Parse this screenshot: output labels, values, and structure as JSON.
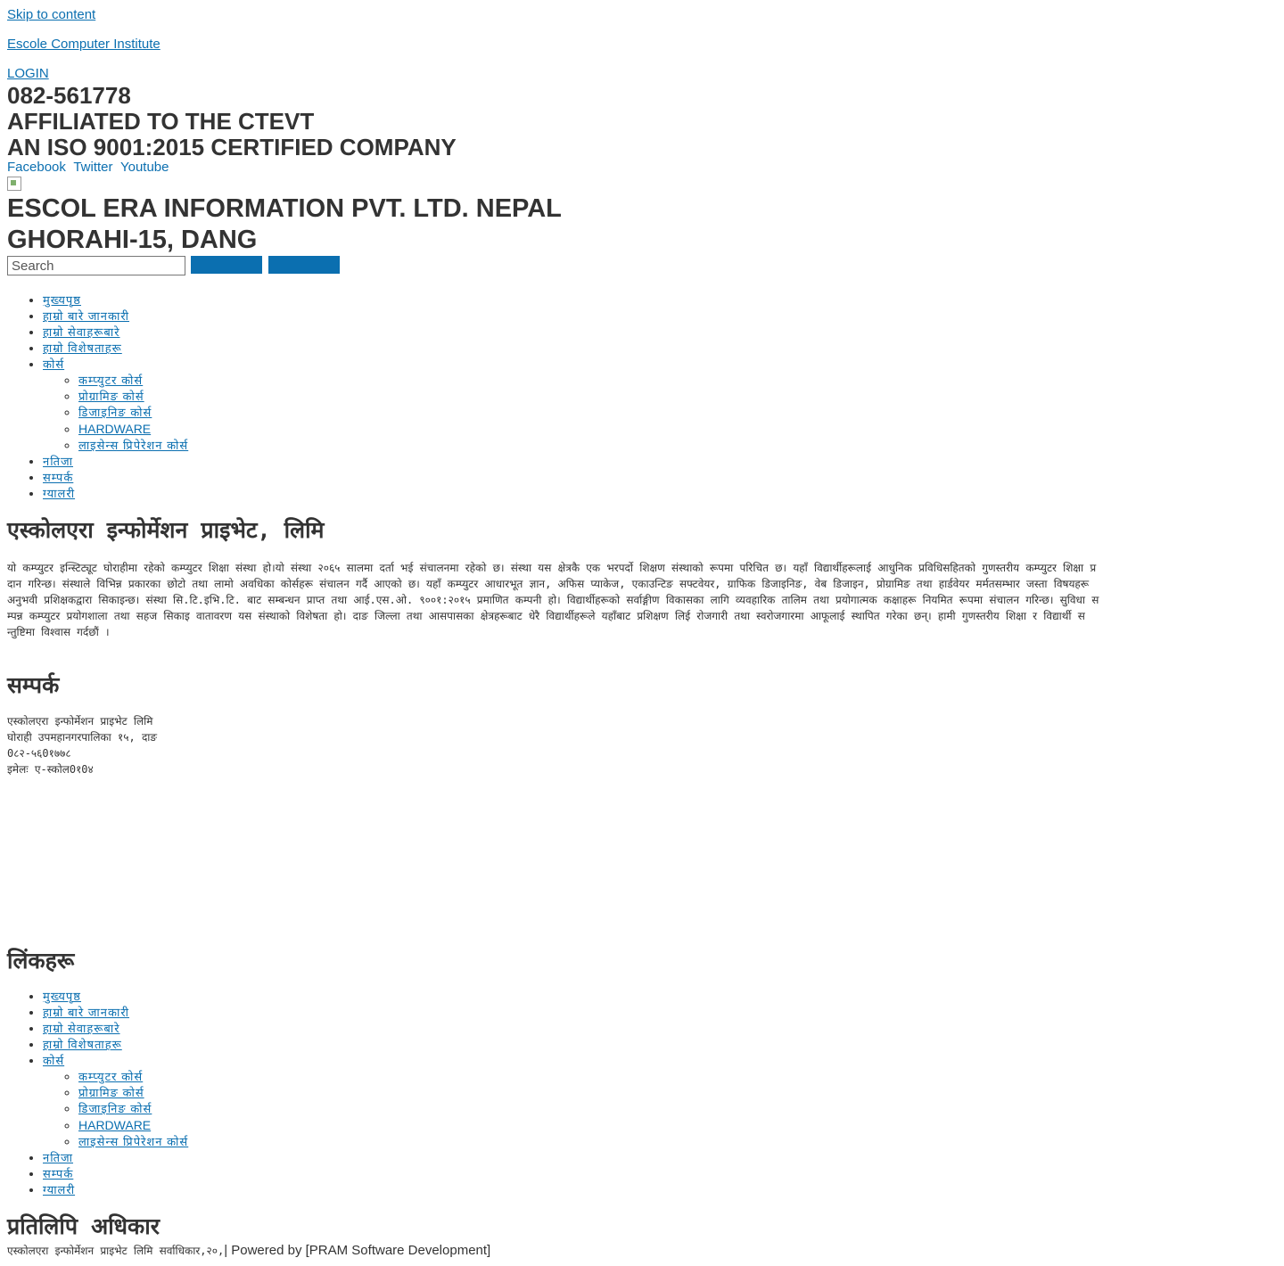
{
  "skip_link": "Skip to content",
  "site_title": "Escole Computer Institute",
  "login": "LOGIN",
  "phone": "082-561778",
  "affiliation": "AFFILIATED TO THE CTEVT",
  "certification": "AN ISO 9001:2015 CERTIFIED COMPANY",
  "social": [
    "Facebook",
    "Twitter",
    "Youtube"
  ],
  "company_name": "ESCOL ERA INFORMATION PVT. LTD. NEPAL",
  "company_address": "GHORAHI-15, DANG",
  "search": {
    "placeholder": "Search"
  },
  "nav": {
    "items": [
      "मुख्यपृष्ठ",
      "हाम्रो बारे जानकारी",
      "हाम्रो सेवाहरूबारे",
      "हाम्रो विशेषताहरू",
      "कोर्स"
    ],
    "sub_items": [
      "कम्प्युटर कोर्स",
      "प्रोग्रामिङ कोर्स",
      "डिजाइनिङ कोर्स",
      "HARDWARE",
      "लाइसेन्स प्रिपेरेशन कोर्स"
    ],
    "after_items": [
      "नतिजा",
      "सम्पर्क",
      "ग्यालरी"
    ]
  },
  "main": {
    "heading": "एस्कोलएरा इन्फोर्मेशन प्राइभेट, लिमि",
    "paragraph": "यो कम्प्युटर इन्स्टिट्यूट घोराहीमा रहेको कम्प्युटर शिक्षा संस्था हो।यो संस्था २०६५ सालमा दर्ता भई संचालनमा रहेको छ। संस्था यस क्षेत्रकै एक भरपर्दो शिक्षण संस्थाको रूपमा परिचित छ। यहाँ विद्यार्थीहरूलाई आधुनिक प्रविधिसहितको गुणस्तरीय कम्प्युटर शिक्षा प्रदान गरिन्छ। संस्थाले विभिन्न प्रकारका छोटो तथा लामो अवधिका कोर्सहरू संचालन गर्दै आएको छ। यहाँ कम्प्युटर आधारभूत ज्ञान, अफिस प्याकेज, एकाउन्टिङ सफ्टवेयर, ग्राफिक डिजाइनिङ, वेब डिजाइन, प्रोग्रामिङ तथा हार्डवेयर मर्मतसम्भार जस्ता विषयहरू अनुभवी प्रशिक्षकद्वारा सिकाइन्छ। संस्था सि.टि.इभि.टि. बाट सम्बन्धन प्राप्त तथा आई.एस.ओ. ९००१:२०१५ प्रमाणित कम्पनी हो। विद्यार्थीहरूको सर्वाङ्गीण विकासका लागि व्यवहारिक तालिम तथा प्रयोगात्मक कक्षाहरू नियमित रूपमा संचालन गरिन्छ। सुविधा सम्पन्न कम्प्युटर प्रयोगशाला तथा सहज सिकाइ वातावरण यस संस्थाको विशेषता हो। दाङ जिल्ला तथा आसपासका क्षेत्रहरूबाट धेरै विद्यार्थीहरूले यहाँबाट प्रशिक्षण लिई रोजगारी तथा स्वरोजगारमा आफूलाई स्थापित गरेका छन्। हामी गुणस्तरीय शिक्षा र विद्यार्थी सन्तुष्टिमा विश्वास गर्दछौं ।"
  },
  "contact": {
    "heading": "सम्पर्क",
    "lines": [
      "एस्कोलएरा इन्फोर्मेशन प्राइभेट लिमि",
      "घोराही उपमहानगरपालिका १५, दाङ",
      "0८२-५६0१७७८",
      "इमेलः ए-स्कोल0१0४"
    ]
  },
  "links_heading": "लिंकहरू",
  "footer": {
    "heading": "प्रतिलिपि अधिकार",
    "copyright": "एस्कोलएरा इन्फोर्मेशन प्राइभेट लिमि सर्वाधिकार,२०,",
    "credit": "| Powered by [PRAM Software Development]"
  },
  "colors": {
    "link": "#0b6fb0",
    "text": "#333333",
    "button": "#0b6fb0"
  }
}
